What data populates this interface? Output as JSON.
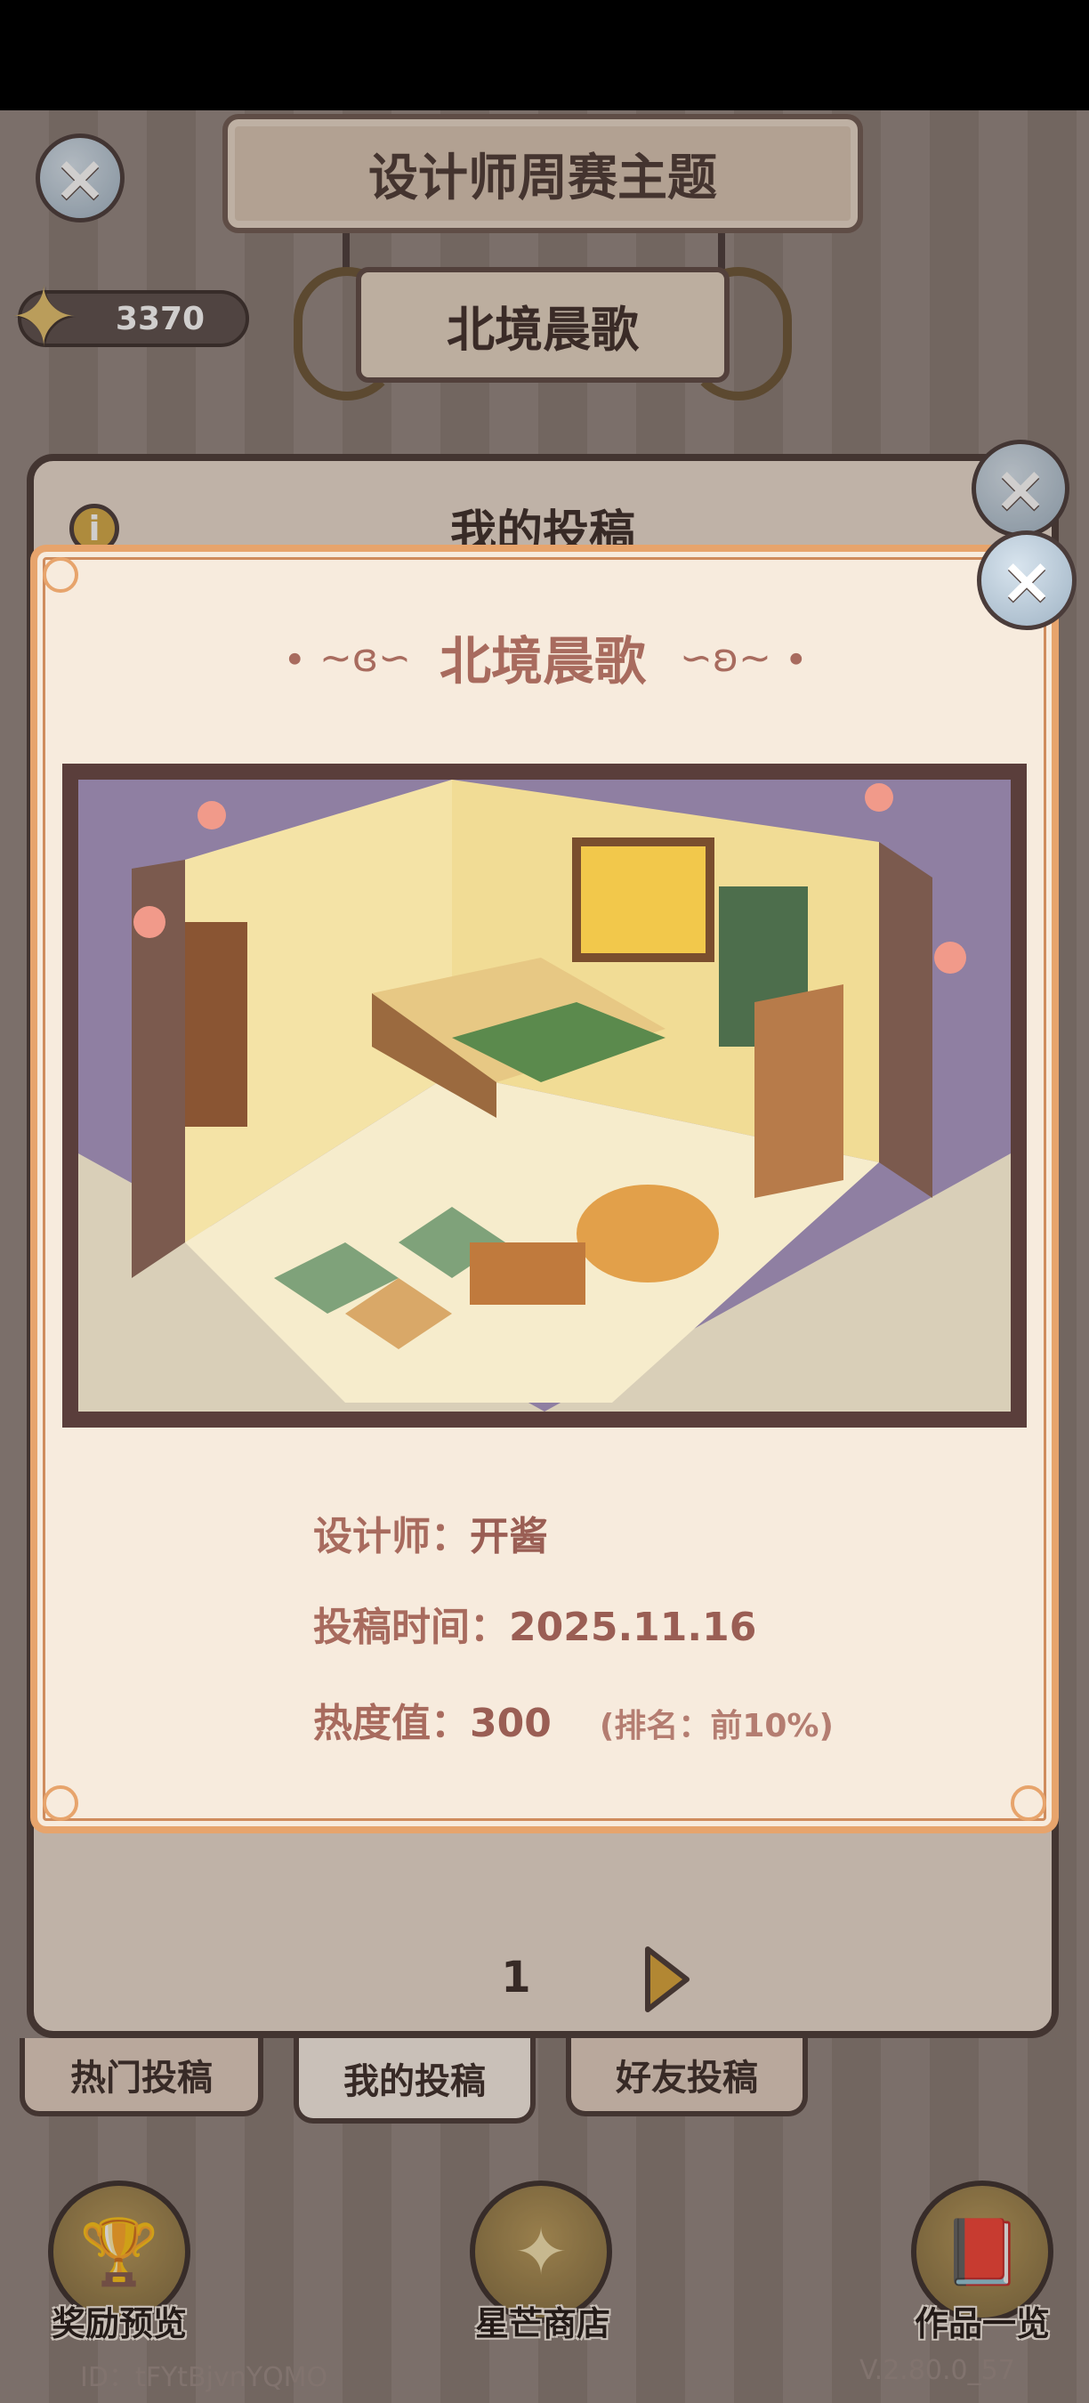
{
  "header": {
    "title": "设计师周赛主题",
    "theme_name": "北境晨歌",
    "star_count": "3370"
  },
  "back_panel": {
    "title": "我的投稿"
  },
  "pager": {
    "page": "1"
  },
  "tabs": [
    {
      "label": "热门投稿"
    },
    {
      "label": "我的投稿"
    },
    {
      "label": "好友投稿"
    }
  ],
  "bottom_nav": [
    {
      "label": "奖励预览",
      "icon": "trophy-icon"
    },
    {
      "label": "星芒商店",
      "icon": "star-shop-icon"
    },
    {
      "label": "作品一览",
      "icon": "book-icon"
    }
  ],
  "footer": {
    "id": "ID：tFYtBjvnYQMO",
    "version": "V.2.80.0_57"
  },
  "modal": {
    "title": "北境晨歌",
    "designer_label": "设计师：",
    "designer_value": "开酱",
    "time_label": "投稿时间：",
    "time_value": "2025.11.16",
    "heat_label": "热度值：",
    "heat_value": "300",
    "rank_note": "(排名：前10%)"
  },
  "colors": {
    "modal_bg": "#f7ebdd",
    "modal_border": "#e7a46c",
    "accent_text": "#a86b5e",
    "dark_frame": "#4b3b38"
  }
}
